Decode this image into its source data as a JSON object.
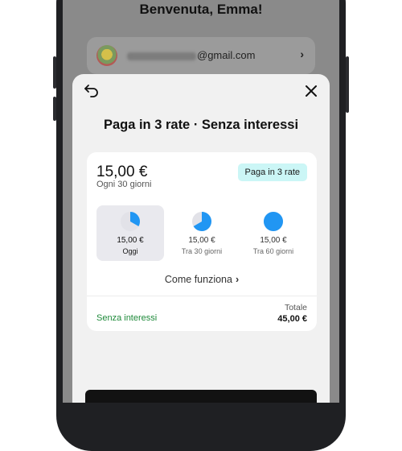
{
  "background": {
    "greeting": "Benvenuta, Emma!",
    "account_email_suffix": "@gmail.com",
    "account_chevron": "›"
  },
  "sheet": {
    "title": "Paga in 3 rate · Senza interessi",
    "icons": {
      "back": "back-arrow-icon",
      "close": "close-icon"
    }
  },
  "plan": {
    "amount": "15,00 €",
    "period": "Ogni 30 giorni",
    "badge": "Paga in 3 rate",
    "badge_color": "#cbf6f6",
    "pie_color": "#2196f3",
    "installments": [
      {
        "amount": "15,00 €",
        "when": "Oggi",
        "filled_fraction": 0.3333,
        "selected": true
      },
      {
        "amount": "15,00 €",
        "when": "Tra 30 giorni",
        "filled_fraction": 0.6667,
        "selected": false
      },
      {
        "amount": "15,00 €",
        "when": "Tra 60 giorni",
        "filled_fraction": 1.0,
        "selected": false
      }
    ],
    "how_it_works": "Come funziona",
    "how_chevron": "›",
    "no_interest": "Senza interessi",
    "no_interest_color": "#1e8a3a",
    "total_label": "Totale",
    "total_amount": "45,00 €"
  }
}
